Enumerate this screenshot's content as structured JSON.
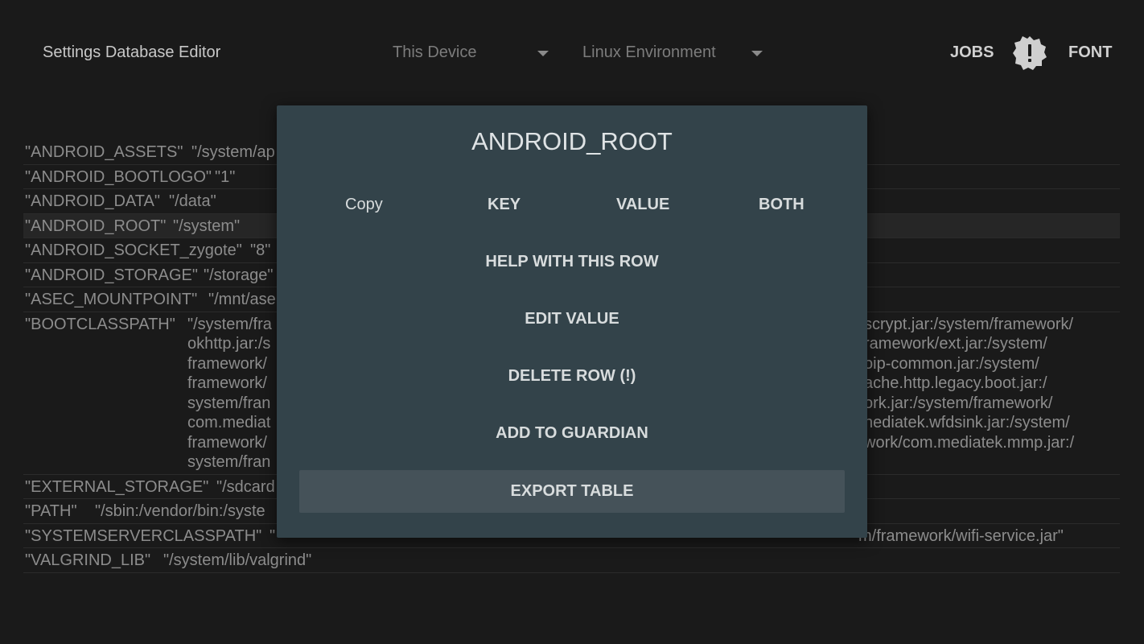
{
  "toolbar": {
    "title": "Settings Database Editor",
    "device_select": "This Device",
    "table_select": "Linux Environment",
    "jobs_label": "JOBS",
    "font_label": "FONT"
  },
  "table": {
    "rows": [
      {
        "key": "\"ANDROID_ASSETS\"",
        "value_lines": [
          "\"/system/ap"
        ]
      },
      {
        "key": "\"ANDROID_BOOTLOGO\"",
        "value_lines": [
          "\"1\""
        ]
      },
      {
        "key": "\"ANDROID_DATA\"",
        "value_lines": [
          "\"/data\""
        ]
      },
      {
        "key": "\"ANDROID_ROOT\"",
        "value_lines": [
          "\"/system\""
        ],
        "selected": true
      },
      {
        "key": "\"ANDROID_SOCKET_zygote\"",
        "value_lines": [
          "\"8\""
        ]
      },
      {
        "key": "\"ANDROID_STORAGE\"",
        "value_lines": [
          "\"/storage\""
        ]
      },
      {
        "key": "\"ASEC_MOUNTPOINT\"",
        "value_lines": [
          "\"/mnt/ase"
        ]
      },
      {
        "key": "\"BOOTCLASSPATH\"",
        "value_lines": [
          "\"/system/fra",
          "okhttp.jar:/s",
          "framework/",
          "framework/",
          "system/fran",
          "com.mediat",
          "framework/",
          "system/fran"
        ],
        "value_right_lines": [
          "scrypt.jar:/system/framework/",
          "ramework/ext.jar:/system/",
          "oip-common.jar:/system/",
          "ache.http.legacy.boot.jar:/",
          "ork.jar:/system/framework/",
          "nediatek.wfdsink.jar:/system/",
          "work/com.mediatek.mmp.jar:/",
          ""
        ]
      },
      {
        "key": "\"EXTERNAL_STORAGE\"",
        "value_lines": [
          "\"/sdcard"
        ]
      },
      {
        "key": "\"PATH\"",
        "value_lines": [
          "\"/sbin:/vendor/bin:/syste"
        ]
      },
      {
        "key": "\"SYSTEMSERVERCLASSPATH\"",
        "value_lines": [
          "\""
        ],
        "value_right_lines": [
          "m/framework/wifi-service.jar\""
        ]
      },
      {
        "key": "\"VALGRIND_LIB\"",
        "value_lines": [
          "\"/system/lib/valgrind\""
        ]
      }
    ]
  },
  "dialog": {
    "title": "ANDROID_ROOT",
    "copy_label": "Copy",
    "copy_key": "KEY",
    "copy_value": "VALUE",
    "copy_both": "BOTH",
    "help": "HELP WITH THIS ROW",
    "edit": "EDIT VALUE",
    "delete": "DELETE ROW (!)",
    "guardian": "ADD TO GUARDIAN",
    "export": "EXPORT TABLE"
  },
  "colors": {
    "background": "#1a1a1a",
    "dialog": "#33434a",
    "dialog_button": "#455259"
  },
  "icons": {
    "alert": "alert-badge-icon",
    "dropdown": "dropdown-arrow-icon"
  }
}
